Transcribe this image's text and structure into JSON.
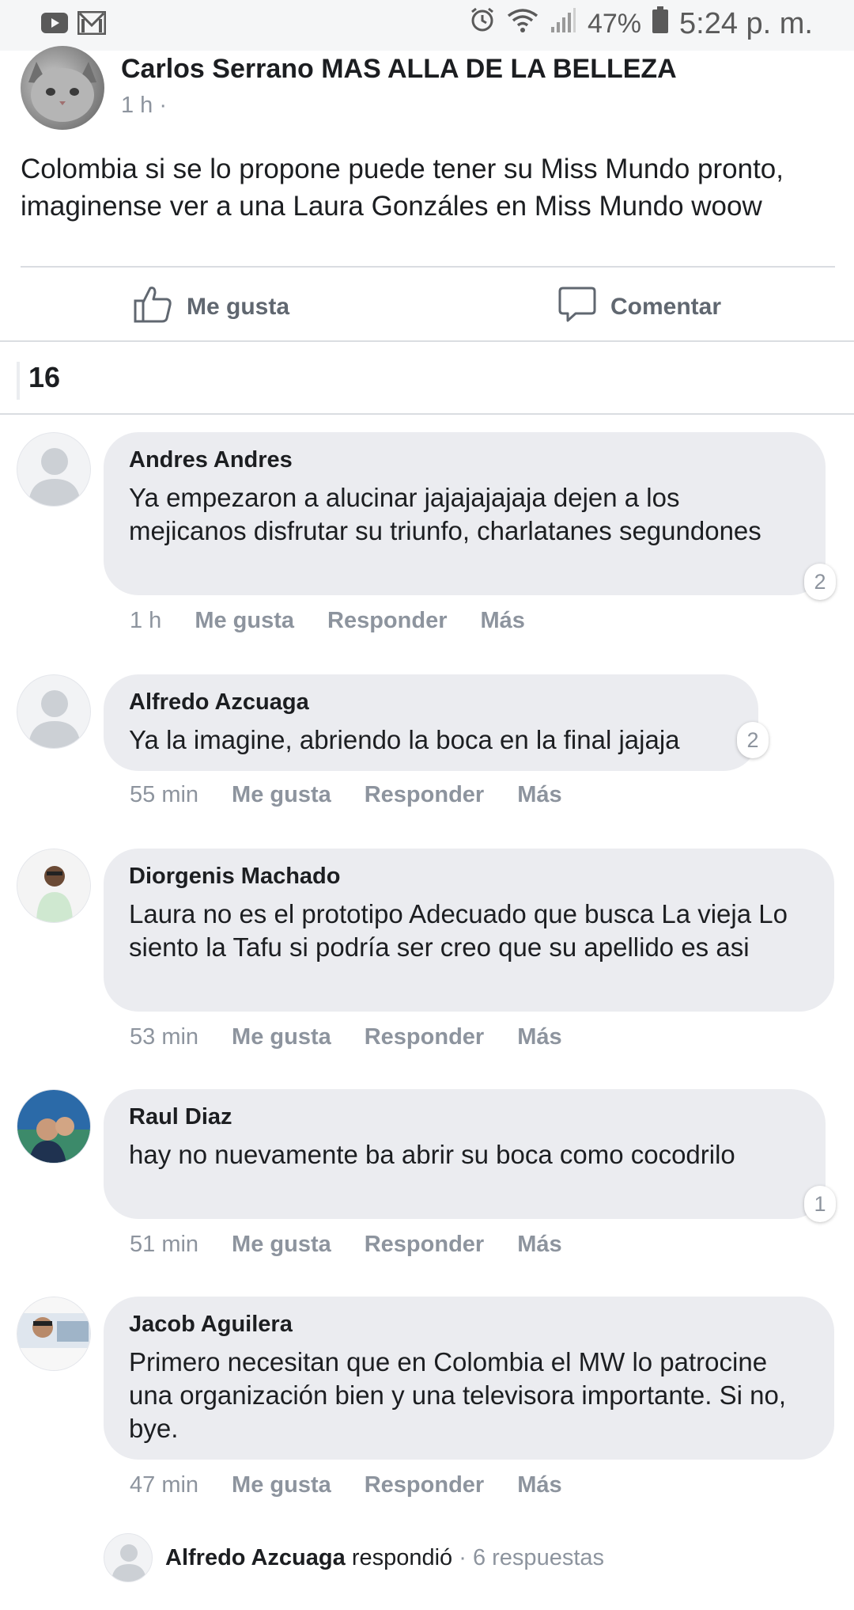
{
  "status_bar": {
    "battery": "47%",
    "time": "5:24 p. m."
  },
  "post": {
    "author": "Carlos Serrano MAS ALLA DE LA BELLEZA",
    "time": "1 h ·",
    "text": "Colombia si se lo propone puede tener su Miss Mundo pronto, imaginense ver a una Laura Gonzáles en Miss Mundo woow"
  },
  "actions": {
    "like_label": "Me gusta",
    "comment_label": "Comentar"
  },
  "reaction_count": "16",
  "comments": [
    {
      "name": "Andres Andres",
      "text": "Ya empezaron a alucinar jajajajajaja dejen a los mejicanos disfrutar su triunfo, charlatanes segundones",
      "reactions": "2",
      "time": "1 h",
      "like": "Me gusta",
      "reply": "Responder",
      "more": "Más"
    },
    {
      "name": "Alfredo Azcuaga",
      "text": "Ya la imagine, abriendo la boca en la final jajaja",
      "reactions": "2",
      "time": "55 min",
      "like": "Me gusta",
      "reply": "Responder",
      "more": "Más"
    },
    {
      "name": "Diorgenis Machado",
      "text": "Laura no es el prototipo Adecuado que busca La vieja Lo siento la Tafu si podría ser creo que su apellido es asi",
      "reactions": "",
      "time": "53 min",
      "like": "Me gusta",
      "reply": "Responder",
      "more": "Más"
    },
    {
      "name": "Raul Diaz",
      "text": "hay no nuevamente ba abrir su boca como cocodrilo",
      "reactions": "1",
      "time": "51 min",
      "like": "Me gusta",
      "reply": "Responder",
      "more": "Más"
    },
    {
      "name": "Jacob Aguilera",
      "text": "Primero necesitan que en Colombia el MW lo patrocine una organización bien y una televisora importante. Si no, bye.",
      "reactions": "",
      "time": "47 min",
      "like": "Me gusta",
      "reply": "Responder",
      "more": "Más"
    }
  ],
  "reply_summary": {
    "name": "Alfredo Azcuaga",
    "action": "respondió",
    "count": "· 6 respuestas"
  }
}
